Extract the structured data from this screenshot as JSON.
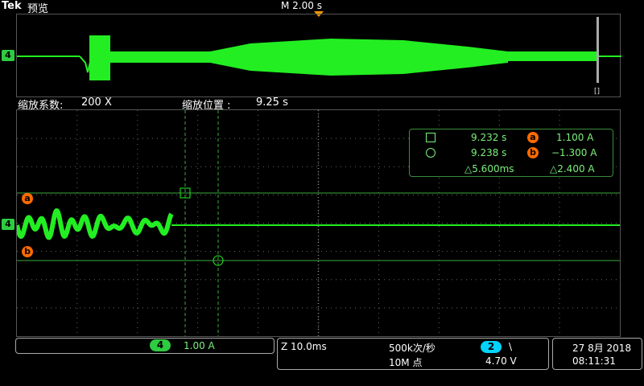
{
  "header": {
    "brand": "Tek",
    "mode": "预览",
    "timebase": "M 2.00 s"
  },
  "zoom": {
    "factor_label": "缩放系数:",
    "factor_value": "200 X",
    "position_label": "缩放位置 :",
    "position_value": "9.25 s"
  },
  "markers": {
    "a": "a",
    "b": "b",
    "channel4": "4"
  },
  "cursors": {
    "c1_time": "9.232 s",
    "c2_time": "9.238 s",
    "delta_time": "△5.600ms",
    "a_value": "1.100 A",
    "b_value": "−1.300 A",
    "delta_value": "△2.400 A"
  },
  "footer": {
    "channel": "4",
    "channel_scale": "1.00 A",
    "zoom_scale": "Z 10.0ms",
    "sample_rate": "500k次/秒",
    "record_length": "10M 点",
    "trigger_channel": "2",
    "trigger_slope": "\\",
    "trigger_level": "4.70 V",
    "date": "27 8月 2018",
    "time": "08:11:31"
  },
  "colors": {
    "trace": "#22ee22",
    "marker": "#ff6a00",
    "trigger": "#00d4ff"
  }
}
